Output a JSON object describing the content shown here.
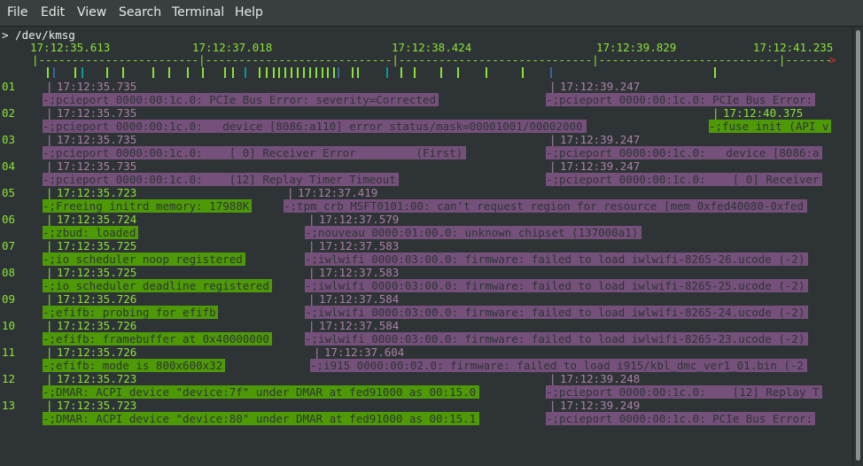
{
  "menu": [
    "File",
    "Edit",
    "View",
    "Search",
    "Terminal",
    "Help"
  ],
  "terminal": {
    "title": "> /dev/kmsg",
    "ticks": [
      "17:12:35.613",
      "17:12:37.018",
      "17:12:38.424",
      "17:12:39.829",
      "17:12:41.235"
    ],
    "axis": "|------------------------|----------------------------|-----------------------------|---------------------------|-------------------------",
    "axis_arrow": ">",
    "rows": [
      {
        "num": "01",
        "a": {
          "ts": "17:12:35.735",
          "msg": "-;pcieport 0000:00:1c.0: PCIe Bus Error: severity=Corrected",
          "color": "purple"
        },
        "b": {
          "ts": "17:12:39.247",
          "msg": "-;pcieport 0000:00:1c.0: PCIe Bus Error:",
          "color": "purple"
        }
      },
      {
        "num": "02",
        "a": {
          "ts": "17:12:35.735",
          "msg": "-;pcieport 0000:00:1c.0:   device [8086:a110] error status/mask=00001001/00002000",
          "color": "purple"
        },
        "b": {
          "ts": "17:12:40.375",
          "msg": "-;fuse init (API v",
          "color": "green"
        }
      },
      {
        "num": "03",
        "a": {
          "ts": "17:12:35.735",
          "msg": "-;pcieport 0000:00:1c.0:    [ 0] Receiver Error         (First)",
          "color": "purple"
        },
        "b": {
          "ts": "17:12:39.247",
          "msg": "-;pcieport 0000:00:1c.0:   device [8086:a",
          "color": "purple"
        }
      },
      {
        "num": "04",
        "a": {
          "ts": "17:12:35.735",
          "msg": "-;pcieport 0000:00:1c.0:    [12] Replay Timer Timeout",
          "color": "purple"
        },
        "b": {
          "ts": "17:12:39.247",
          "msg": "-;pcieport 0000:00:1c.0:    [ 0] Receiver",
          "color": "purple"
        }
      },
      {
        "num": "05",
        "a": {
          "ts": "17:12:35.723",
          "msg": "-;Freeing initrd memory: 17988K",
          "color": "green"
        },
        "b": {
          "ts": "17:12:37.419",
          "msg": "-;tpm_crb MSFT0101:00: can't request region for resource [mem 0xfed40080-0xfed",
          "color": "purple"
        }
      },
      {
        "num": "06",
        "a": {
          "ts": "17:12:35.724",
          "msg": "-;zbud: loaded",
          "color": "green"
        },
        "b": {
          "ts": "17:12:37.579",
          "msg": "-;nouveau 0000:01:00.0: unknown chipset (137000a1)",
          "color": "purple"
        }
      },
      {
        "num": "07",
        "a": {
          "ts": "17:12:35.725",
          "msg": "-;io scheduler noop registered",
          "color": "green"
        },
        "b": {
          "ts": "17:12:37.583",
          "msg": "-;iwlwifi 0000:03:00.0: firmware: failed to load iwlwifi-8265-26.ucode (-2)",
          "color": "purple"
        }
      },
      {
        "num": "08",
        "a": {
          "ts": "17:12:35.725",
          "msg": "-;io scheduler deadline registered",
          "color": "green"
        },
        "b": {
          "ts": "17:12:37.583",
          "msg": "-;iwlwifi 0000:03:00.0: firmware: failed to load iwlwifi-8265-25.ucode (-2)",
          "color": "purple"
        }
      },
      {
        "num": "09",
        "a": {
          "ts": "17:12:35.726",
          "msg": "-;efifb: probing for efifb",
          "color": "green"
        },
        "b": {
          "ts": "17:12:37.584",
          "msg": "-;iwlwifi 0000:03:00.0: firmware: failed to load iwlwifi-8265-24.ucode (-2)",
          "color": "purple"
        }
      },
      {
        "num": "10",
        "a": {
          "ts": "17:12:35.726",
          "msg": "-;efifb: framebuffer at 0x40000000",
          "color": "green"
        },
        "b": {
          "ts": "17:12:37.584",
          "msg": "-;iwlwifi 0000:03:00.0: firmware: failed to load iwlwifi-8265-23.ucode (-2)",
          "color": "purple"
        }
      },
      {
        "num": "11",
        "a": {
          "ts": "17:12:35.726",
          "msg": "-;efifb: mode is 800x600x32",
          "color": "green"
        },
        "b": {
          "ts": "17:12:37.604",
          "msg": "-;i915 0000:00:02.0: firmware: failed to load i915/kbl_dmc_ver1_01.bin (-2",
          "color": "purple"
        }
      },
      {
        "num": "12",
        "a": {
          "ts": "17:12:35.723",
          "msg": "-;DMAR: ACPI device \"device:7f\" under DMAR at fed91000 as 00:15.0",
          "color": "green"
        },
        "b": {
          "ts": "17:12:39.248",
          "msg": "-;pcieport 0000:00:1c.0:    [12] Replay T",
          "color": "purple"
        }
      },
      {
        "num": "13",
        "a": {
          "ts": "17:12:35.723",
          "msg": "-;DMAR: ACPI device \"device:80\" under DMAR at fed91000 as 00:15.1",
          "color": "green"
        },
        "b": {
          "ts": "17:12:39.249",
          "msg": "-;pcieport 0000:00:1c.0: PCIe Bus Error:",
          "color": "purple"
        }
      }
    ]
  },
  "colors": {
    "green": "#4e9a06",
    "purple": "#75507b",
    "green_text": "#8ae234",
    "purple_text": "#ad7fa8",
    "cyan": "#06989a",
    "blue": "#3465a4",
    "background": "#2e3436"
  }
}
